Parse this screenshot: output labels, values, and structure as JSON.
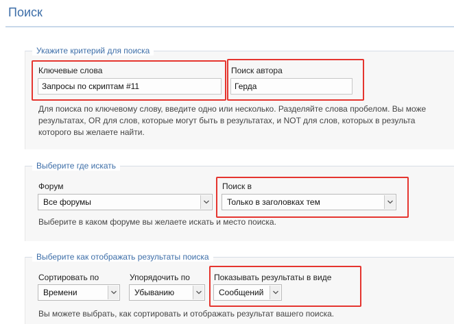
{
  "page": {
    "title": "Поиск"
  },
  "criteria": {
    "legend": "Укажите критерий для поиска",
    "keywords_label": "Ключевые слова",
    "keywords_value": "Запросы по скриптам #11",
    "author_label": "Поиск автора",
    "author_value": "Герда",
    "hint_lines": [
      "Для поиска по ключевому слову, введите одно или несколько. Разделяйте слова пробелом. Вы може",
      "результатах, OR для слов, которые могут быть в результатах, и NOT для слов, которых в результа",
      "которого вы желаете найти."
    ]
  },
  "where": {
    "legend": "Выберите где искать",
    "forum_label": "Форум",
    "forum_value": "Все форумы",
    "search_in_label": "Поиск в",
    "search_in_value": "Только в заголовках тем",
    "hint": "Выберите в каком форуме вы желаете искать и место поиска."
  },
  "display": {
    "legend": "Выберите как отображать результаты поиска",
    "sort_label": "Сортировать по",
    "sort_value": "Времени",
    "order_label": "Упорядочить по",
    "order_value": "Убыванию",
    "show_label": "Показывать результаты в виде",
    "show_value": "Сообщений",
    "hint": "Вы можете выбрать, как сортировать и отображать результат вашего поиска."
  },
  "colors": {
    "accent": "#3d6ea8",
    "highlight": "#e5342e"
  }
}
